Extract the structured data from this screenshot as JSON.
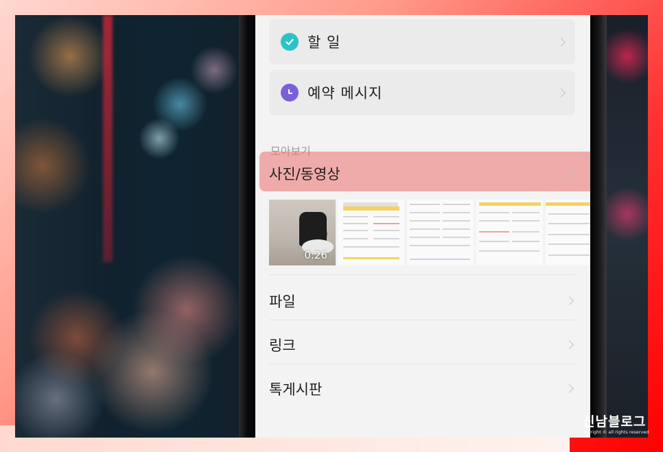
{
  "menu": {
    "todo": {
      "label": "할 일",
      "icon": "check-circle-icon",
      "icon_color": "#2bc3c8"
    },
    "scheduled": {
      "label": "예약 메시지",
      "icon": "clock-icon",
      "icon_color": "#7b5fd9"
    }
  },
  "section": {
    "title": "모아보기"
  },
  "media": {
    "label": "사진/동영상",
    "video_duration": "0:26"
  },
  "rows": {
    "files": "파일",
    "links": "링크",
    "board": "톡게시판"
  },
  "watermark": {
    "title": "신남블로그",
    "subtitle": "copyright © all rights reserved"
  },
  "colors": {
    "highlight": "#eb6e6e",
    "frame_red": "#ff1a1a",
    "screen_bg": "#f3f3f3"
  }
}
